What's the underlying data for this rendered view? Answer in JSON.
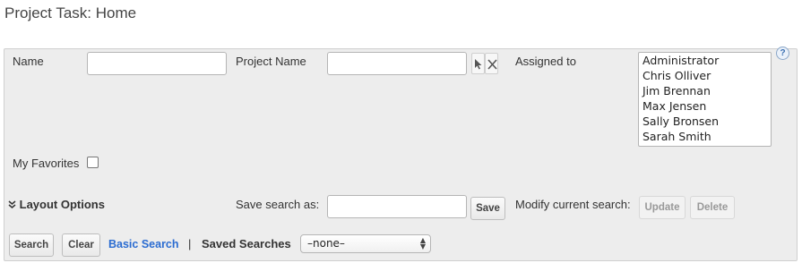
{
  "page": {
    "title": "Project Task: Home"
  },
  "help": {
    "icon": "question-icon",
    "label": "?"
  },
  "form": {
    "name_label": "Name",
    "name_value": "",
    "project_name_label": "Project Name",
    "project_name_value": "",
    "select_icon": "arrow-cursor-icon",
    "clear_icon": "close-icon",
    "assigned_to_label": "Assigned to",
    "assigned_to_options": [
      "Administrator",
      "Chris Olliver",
      "Jim Brennan",
      "Max Jensen",
      "Sally Bronsen",
      "Sarah Smith"
    ],
    "my_favorites_label": "My Favorites",
    "my_favorites_checked": false
  },
  "layout_options": {
    "icon": "double-chevron-down-icon",
    "label": "Layout Options"
  },
  "save_search": {
    "label": "Save search as:",
    "value": "",
    "button": "Save"
  },
  "modify_search": {
    "label": "Modify current search:",
    "update": "Update",
    "delete": "Delete"
  },
  "actions": {
    "search": "Search",
    "clear": "Clear",
    "basic_search": "Basic Search",
    "separator": "|",
    "saved_searches_label": "Saved Searches",
    "saved_searches_value": "–none–"
  }
}
